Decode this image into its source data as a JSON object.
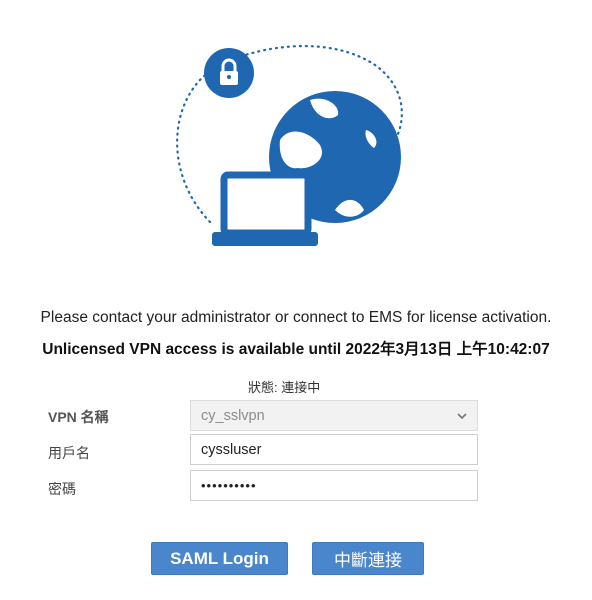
{
  "messages": {
    "license_notice": "Please contact your administrator or connect to EMS for license activation.",
    "unlicensed_notice": "Unlicensed VPN access is available until 2022年3月13日 上午10:42:07"
  },
  "status": {
    "text": "狀態: 連接中"
  },
  "form": {
    "vpn_name": {
      "label": "VPN 名稱",
      "value": "cy_sslvpn"
    },
    "username": {
      "label": "用戶名",
      "value": "cyssluser"
    },
    "password": {
      "label": "密碼",
      "value": "••••••••••"
    }
  },
  "buttons": {
    "saml_login": "SAML Login",
    "disconnect": "中斷連接"
  },
  "icons": {
    "illustration": "vpn-globe-laptop-lock-icon",
    "dropdown": "chevron-down-icon"
  },
  "colors": {
    "brand_blue": "#1f67b1",
    "button_blue": "#4a86cb",
    "disabled_field": "#f2f2f2"
  }
}
